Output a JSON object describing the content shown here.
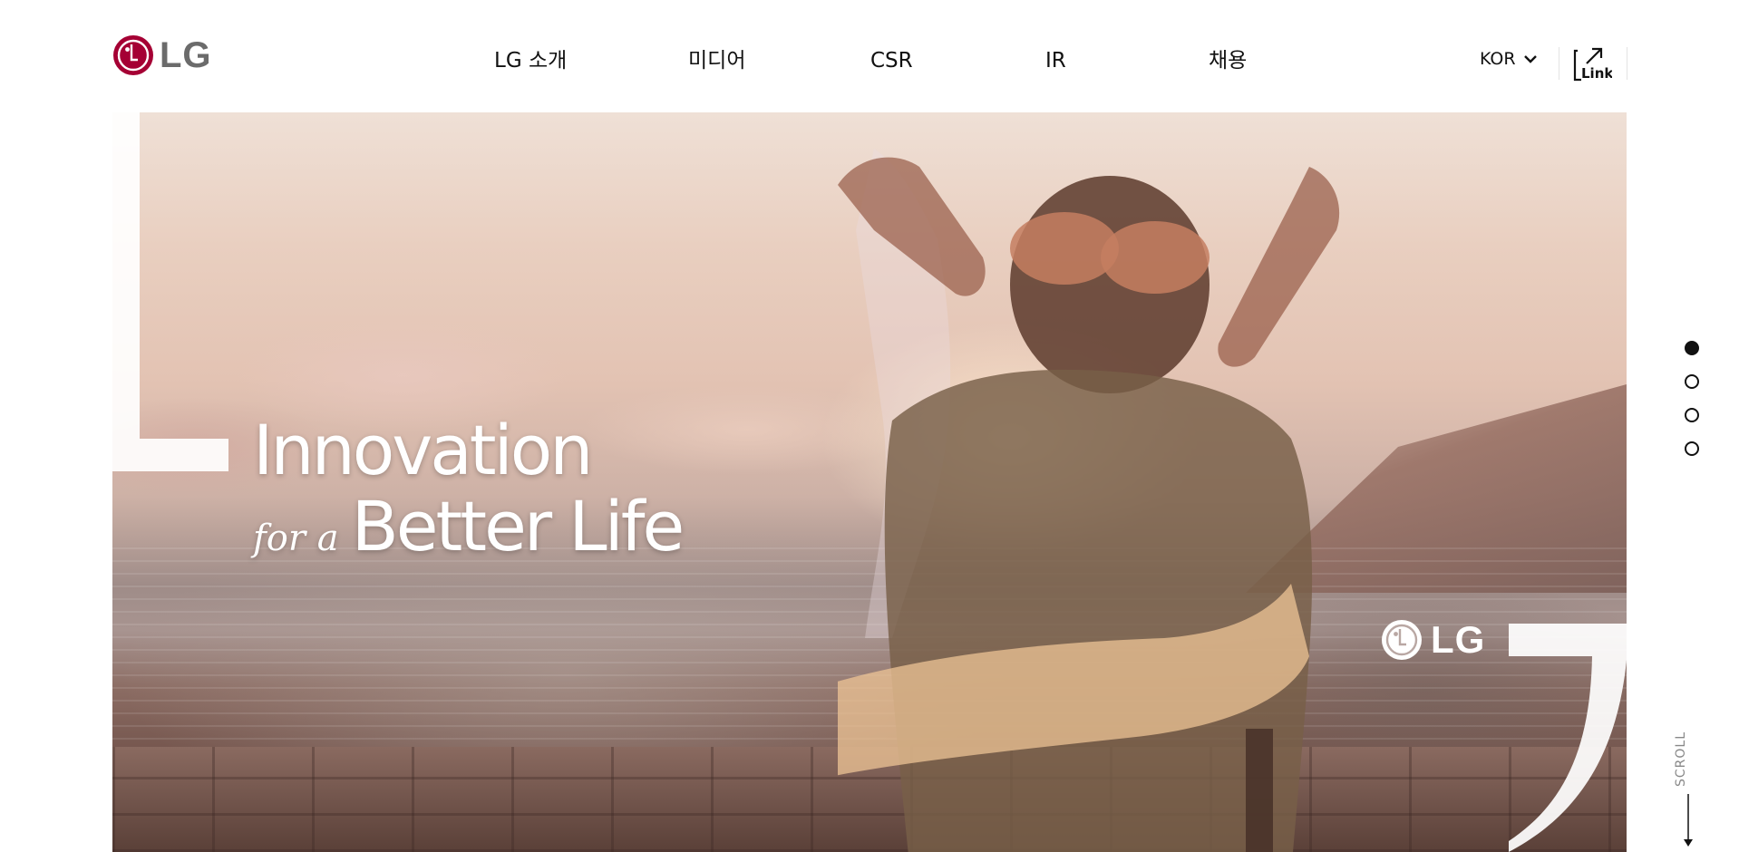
{
  "header": {
    "logo_text": "LG",
    "nav": [
      "LG 소개",
      "미디어",
      "CSR",
      "IR",
      "채용"
    ],
    "language": "KOR",
    "link_label": "Link"
  },
  "hero": {
    "tagline_line1": "Innovation",
    "tagline_small": "for a",
    "tagline_big": "Better Life",
    "logo_text": "LG"
  },
  "pager": {
    "count": 4,
    "active_index": 0
  },
  "scroll_label": "SCROLL",
  "colors": {
    "brand_red": "#a50034",
    "text": "#111111",
    "gray": "#6b6b6b"
  },
  "icons": [
    "lg-logo-icon",
    "chevron-down-icon",
    "external-link-icon",
    "arrow-down-icon"
  ]
}
